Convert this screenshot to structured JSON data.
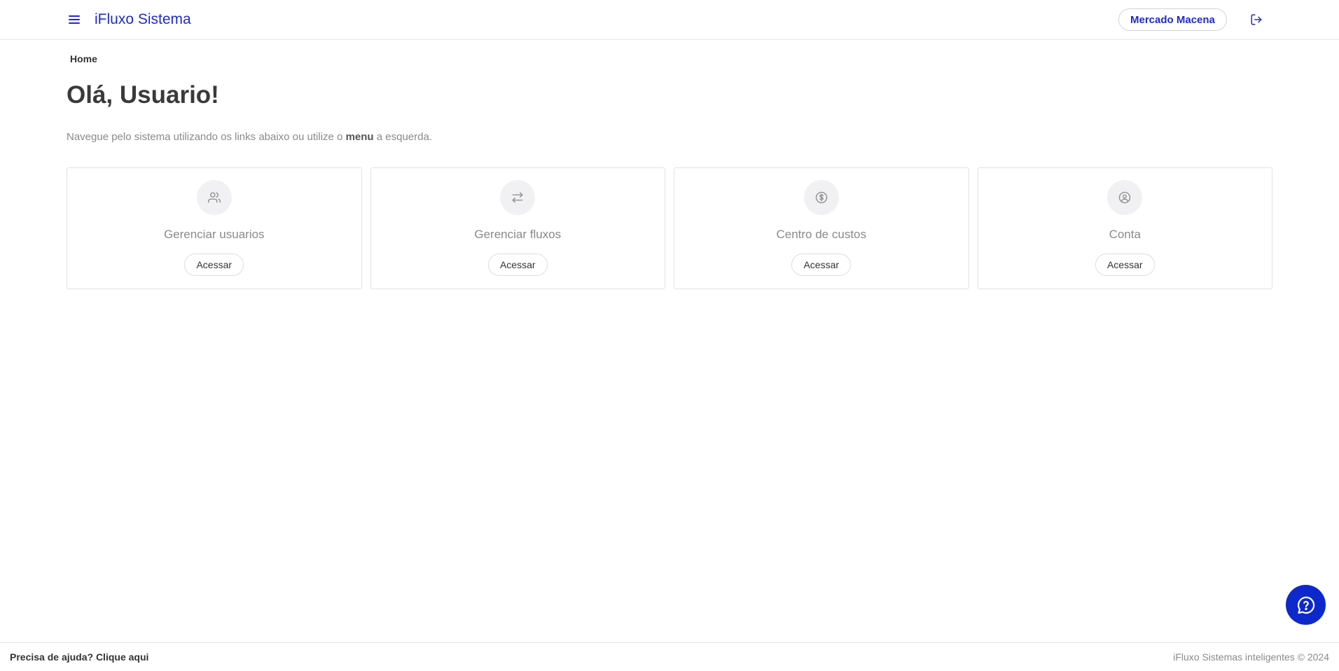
{
  "header": {
    "brand": "iFluxo Sistema",
    "company_label": "Mercado Macena",
    "menu_icon": "menu-icon",
    "logout_icon": "logout-icon"
  },
  "breadcrumb": "Home",
  "main": {
    "title": "Olá, Usuario!",
    "intro_before": "Navegue pelo sistema utilizando os links abaixo ou utilize o ",
    "intro_bold": "menu",
    "intro_after": " a esquerda.",
    "cards": [
      {
        "icon": "users-icon",
        "title": "Gerenciar usuarios",
        "button": "Acessar"
      },
      {
        "icon": "swap-arrows-icon",
        "title": "Gerenciar fluxos",
        "button": "Acessar"
      },
      {
        "icon": "dollar-circle-icon",
        "title": "Centro de custos",
        "button": "Acessar"
      },
      {
        "icon": "user-circle-icon",
        "title": "Conta",
        "button": "Acessar"
      }
    ]
  },
  "help_fab_icon": "help-chat-icon",
  "footer": {
    "help_link": "Precisa de ajuda? Clique aqui",
    "copyright": "iFluxo Sistemas inteligentes © 2024"
  },
  "colors": {
    "brand_blue": "#1f2bc9",
    "fab_blue": "#0d29cc",
    "muted_text": "#8a8a8a",
    "border": "#e2e2e6"
  }
}
